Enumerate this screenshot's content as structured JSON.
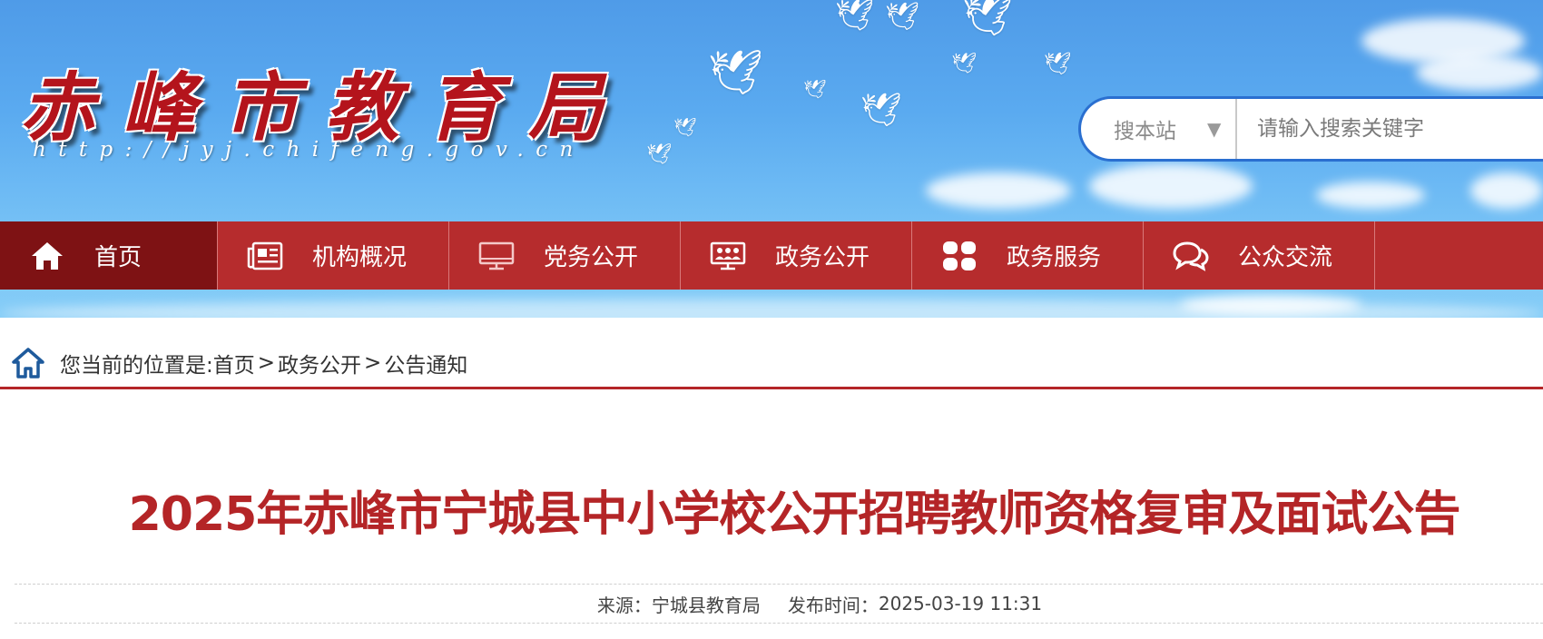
{
  "header": {
    "site_name": "赤峰市教育局",
    "site_url": "http://jyj.chifeng.gov.cn"
  },
  "search": {
    "scope_label": "搜本站",
    "scope_caret": "▼",
    "placeholder": "请输入搜索关键字"
  },
  "nav": {
    "items": [
      {
        "label": "首页",
        "icon": "home-icon"
      },
      {
        "label": "机构概况",
        "icon": "newspaper-icon"
      },
      {
        "label": "党务公开",
        "icon": "monitor-icon"
      },
      {
        "label": "政务公开",
        "icon": "meeting-icon"
      },
      {
        "label": "政务服务",
        "icon": "grid-icon"
      },
      {
        "label": "公众交流",
        "icon": "chat-icon"
      }
    ]
  },
  "breadcrumb": {
    "prefix": "您当前的位置是:",
    "items": [
      "首页",
      "政务公开",
      "公告通知"
    ],
    "separator": ">"
  },
  "article": {
    "title": "2025年赤峰市宁城县中小学校公开招聘教师资格复审及面试公告",
    "source_label": "来源：",
    "source": "宁城县教育局",
    "time_label": "发布时间：",
    "time": "2025-03-19 11:31"
  },
  "colors": {
    "brand_red": "#b62c2d",
    "nav_active": "#7e1214",
    "title_red": "#b42527",
    "search_border": "#2a6fd0"
  }
}
